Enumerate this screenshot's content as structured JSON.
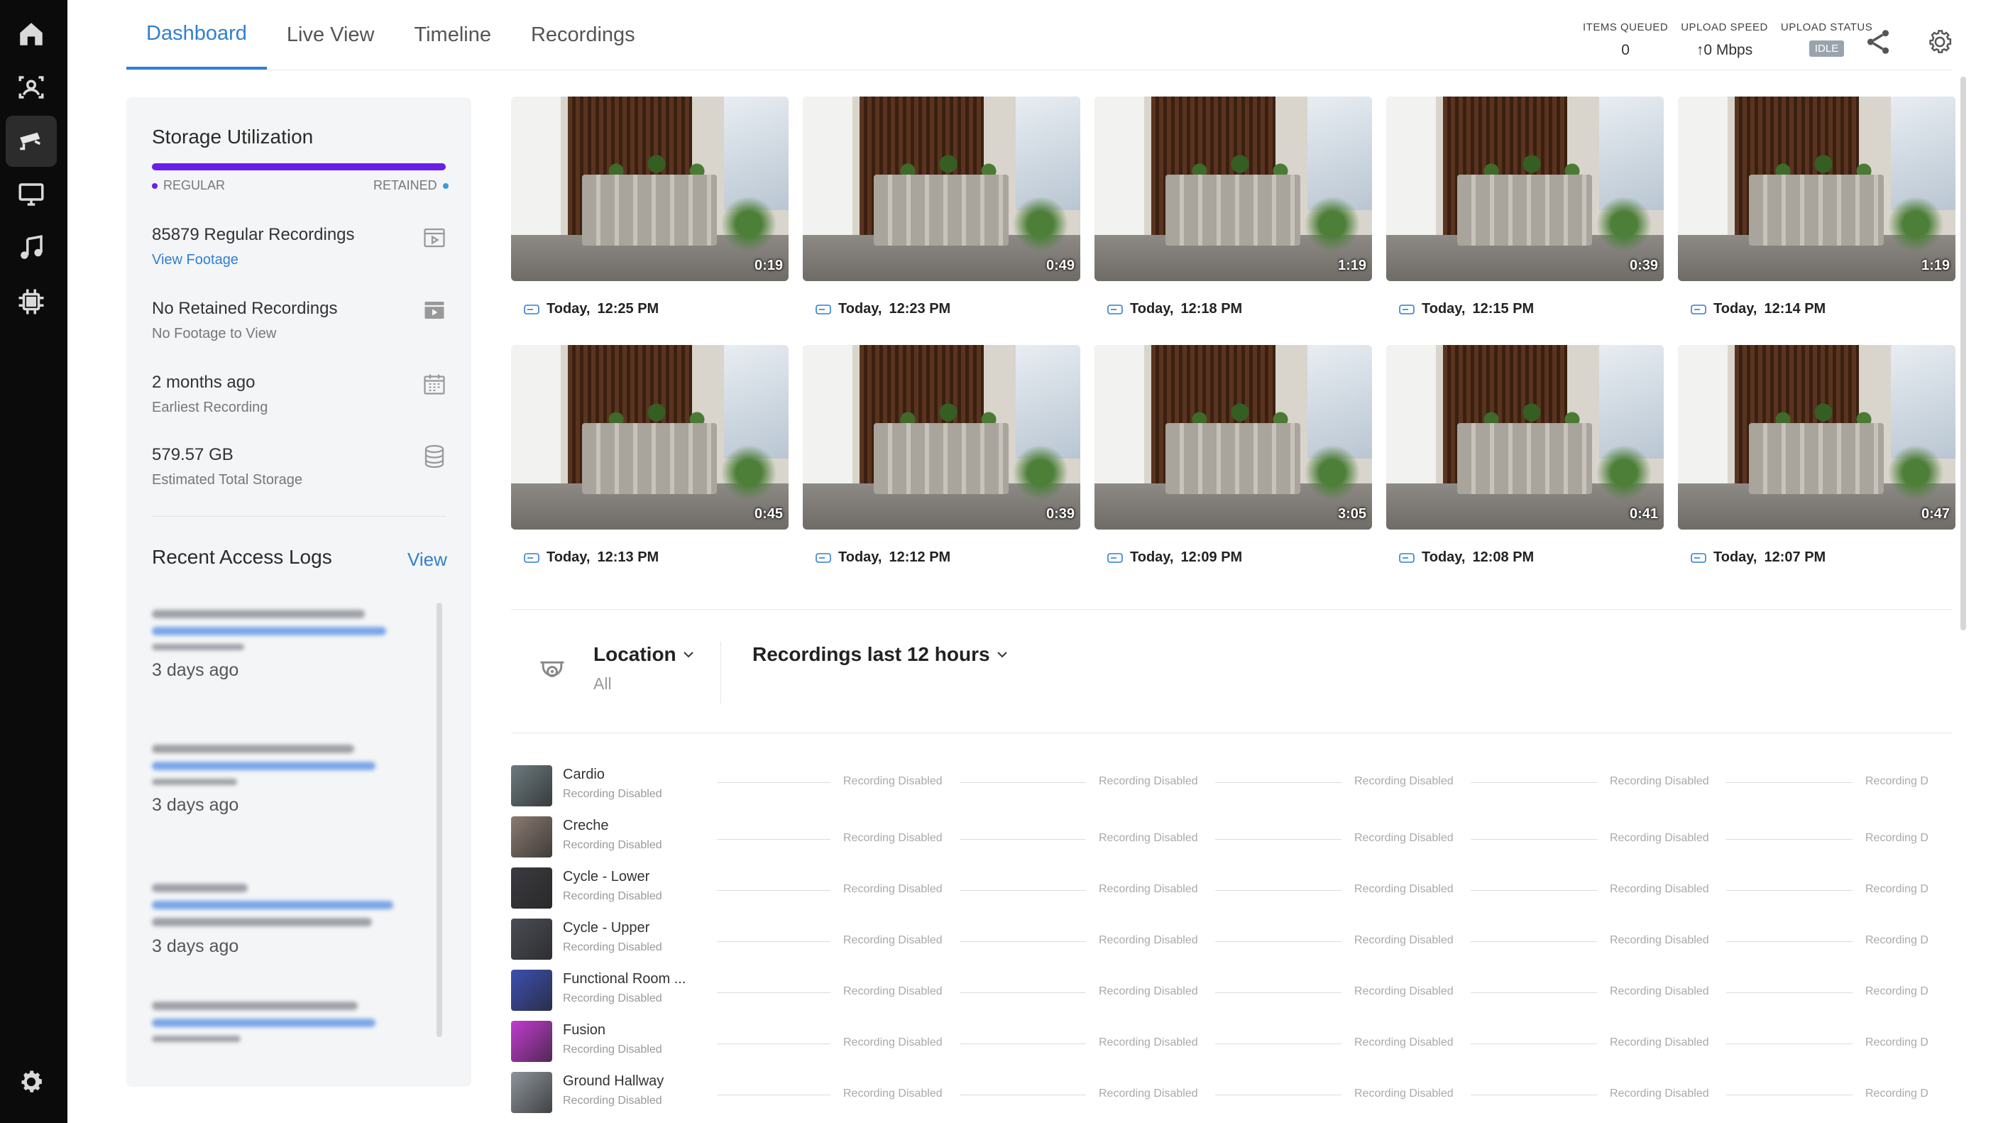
{
  "tabs": [
    {
      "label": "Dashboard",
      "active": true
    },
    {
      "label": "Live View",
      "active": false
    },
    {
      "label": "Timeline",
      "active": false
    },
    {
      "label": "Recordings",
      "active": false
    }
  ],
  "header_stats": {
    "items_queued": {
      "label": "ITEMS QUEUED",
      "value": "0"
    },
    "upload_speed": {
      "label": "UPLOAD SPEED",
      "value": "↑0 Mbps"
    },
    "upload_status": {
      "label": "UPLOAD STATUS",
      "value": "IDLE"
    }
  },
  "storage": {
    "title": "Storage Utilization",
    "legend_regular": "REGULAR",
    "legend_retained": "RETAINED",
    "regular_color": "#6a1ee8",
    "retained_color": "#3b9ad9",
    "items": [
      {
        "main": "85879 Regular Recordings",
        "sub": "View Footage",
        "icon": "video-file-icon"
      },
      {
        "main": "No Retained Recordings",
        "sub": "No Footage to View",
        "icon": "video-file-filled-icon"
      },
      {
        "main": "2 months ago",
        "sub": "Earliest Recording",
        "icon": "calendar-icon"
      },
      {
        "main": "579.57 GB",
        "sub": "Estimated Total Storage",
        "icon": "database-icon"
      }
    ]
  },
  "access_logs": {
    "title": "Recent Access Logs",
    "view_label": "View",
    "entries": [
      {
        "time": "3 days ago"
      },
      {
        "time": "3 days ago"
      },
      {
        "time": "3 days ago"
      }
    ]
  },
  "recordings": [
    {
      "date": "Today,",
      "time": "12:25 PM",
      "duration": "0:19"
    },
    {
      "date": "Today,",
      "time": "12:23 PM",
      "duration": "0:49"
    },
    {
      "date": "Today,",
      "time": "12:18 PM",
      "duration": "1:19"
    },
    {
      "date": "Today,",
      "time": "12:15 PM",
      "duration": "0:39"
    },
    {
      "date": "Today,",
      "time": "12:14 PM",
      "duration": "1:19"
    },
    {
      "date": "Today,",
      "time": "12:13 PM",
      "duration": "0:45"
    },
    {
      "date": "Today,",
      "time": "12:12 PM",
      "duration": "0:39"
    },
    {
      "date": "Today,",
      "time": "12:09 PM",
      "duration": "3:05"
    },
    {
      "date": "Today,",
      "time": "12:08 PM",
      "duration": "0:41"
    },
    {
      "date": "Today,",
      "time": "12:07 PM",
      "duration": "0:47"
    }
  ],
  "filters": {
    "location_label": "Location",
    "location_value": "All",
    "range_label": "Recordings last 12 hours"
  },
  "cameras": [
    {
      "name": "Cardio",
      "status": "Recording Disabled",
      "color": "#6d7a7f"
    },
    {
      "name": "Creche",
      "status": "Recording Disabled",
      "color": "#8a7b72"
    },
    {
      "name": "Cycle - Lower",
      "status": "Recording Disabled",
      "color": "#3b3b40"
    },
    {
      "name": "Cycle - Upper",
      "status": "Recording Disabled",
      "color": "#4a4d55"
    },
    {
      "name": "Functional Room ...",
      "status": "Recording Disabled",
      "color": "#3d4fb0"
    },
    {
      "name": "Fusion",
      "status": "Recording Disabled",
      "color": "#c23bd0"
    },
    {
      "name": "Ground Hallway",
      "status": "Recording Disabled",
      "color": "#8d949a"
    }
  ],
  "timeline_segments": [
    "Recording Disabled",
    "Recording Disabled",
    "Recording Disabled",
    "Recording Disabled",
    "Recording D"
  ]
}
